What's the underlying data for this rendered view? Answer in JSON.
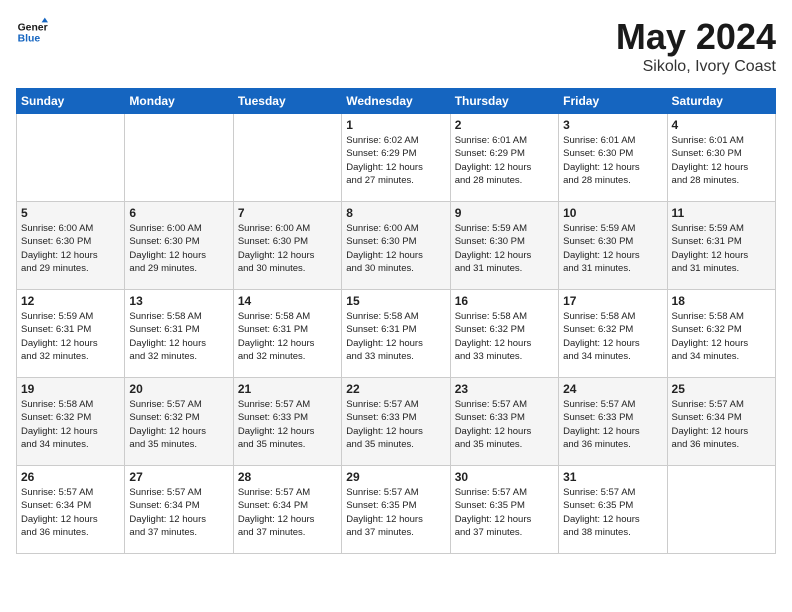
{
  "header": {
    "logo_line1": "General",
    "logo_line2": "Blue",
    "title": "May 2024",
    "subtitle": "Sikolo, Ivory Coast"
  },
  "days_of_week": [
    "Sunday",
    "Monday",
    "Tuesday",
    "Wednesday",
    "Thursday",
    "Friday",
    "Saturday"
  ],
  "weeks": [
    [
      {
        "day": "",
        "info": ""
      },
      {
        "day": "",
        "info": ""
      },
      {
        "day": "",
        "info": ""
      },
      {
        "day": "1",
        "info": "Sunrise: 6:02 AM\nSunset: 6:29 PM\nDaylight: 12 hours\nand 27 minutes."
      },
      {
        "day": "2",
        "info": "Sunrise: 6:01 AM\nSunset: 6:29 PM\nDaylight: 12 hours\nand 28 minutes."
      },
      {
        "day": "3",
        "info": "Sunrise: 6:01 AM\nSunset: 6:30 PM\nDaylight: 12 hours\nand 28 minutes."
      },
      {
        "day": "4",
        "info": "Sunrise: 6:01 AM\nSunset: 6:30 PM\nDaylight: 12 hours\nand 28 minutes."
      }
    ],
    [
      {
        "day": "5",
        "info": "Sunrise: 6:00 AM\nSunset: 6:30 PM\nDaylight: 12 hours\nand 29 minutes."
      },
      {
        "day": "6",
        "info": "Sunrise: 6:00 AM\nSunset: 6:30 PM\nDaylight: 12 hours\nand 29 minutes."
      },
      {
        "day": "7",
        "info": "Sunrise: 6:00 AM\nSunset: 6:30 PM\nDaylight: 12 hours\nand 30 minutes."
      },
      {
        "day": "8",
        "info": "Sunrise: 6:00 AM\nSunset: 6:30 PM\nDaylight: 12 hours\nand 30 minutes."
      },
      {
        "day": "9",
        "info": "Sunrise: 5:59 AM\nSunset: 6:30 PM\nDaylight: 12 hours\nand 31 minutes."
      },
      {
        "day": "10",
        "info": "Sunrise: 5:59 AM\nSunset: 6:30 PM\nDaylight: 12 hours\nand 31 minutes."
      },
      {
        "day": "11",
        "info": "Sunrise: 5:59 AM\nSunset: 6:31 PM\nDaylight: 12 hours\nand 31 minutes."
      }
    ],
    [
      {
        "day": "12",
        "info": "Sunrise: 5:59 AM\nSunset: 6:31 PM\nDaylight: 12 hours\nand 32 minutes."
      },
      {
        "day": "13",
        "info": "Sunrise: 5:58 AM\nSunset: 6:31 PM\nDaylight: 12 hours\nand 32 minutes."
      },
      {
        "day": "14",
        "info": "Sunrise: 5:58 AM\nSunset: 6:31 PM\nDaylight: 12 hours\nand 32 minutes."
      },
      {
        "day": "15",
        "info": "Sunrise: 5:58 AM\nSunset: 6:31 PM\nDaylight: 12 hours\nand 33 minutes."
      },
      {
        "day": "16",
        "info": "Sunrise: 5:58 AM\nSunset: 6:32 PM\nDaylight: 12 hours\nand 33 minutes."
      },
      {
        "day": "17",
        "info": "Sunrise: 5:58 AM\nSunset: 6:32 PM\nDaylight: 12 hours\nand 34 minutes."
      },
      {
        "day": "18",
        "info": "Sunrise: 5:58 AM\nSunset: 6:32 PM\nDaylight: 12 hours\nand 34 minutes."
      }
    ],
    [
      {
        "day": "19",
        "info": "Sunrise: 5:58 AM\nSunset: 6:32 PM\nDaylight: 12 hours\nand 34 minutes."
      },
      {
        "day": "20",
        "info": "Sunrise: 5:57 AM\nSunset: 6:32 PM\nDaylight: 12 hours\nand 35 minutes."
      },
      {
        "day": "21",
        "info": "Sunrise: 5:57 AM\nSunset: 6:33 PM\nDaylight: 12 hours\nand 35 minutes."
      },
      {
        "day": "22",
        "info": "Sunrise: 5:57 AM\nSunset: 6:33 PM\nDaylight: 12 hours\nand 35 minutes."
      },
      {
        "day": "23",
        "info": "Sunrise: 5:57 AM\nSunset: 6:33 PM\nDaylight: 12 hours\nand 35 minutes."
      },
      {
        "day": "24",
        "info": "Sunrise: 5:57 AM\nSunset: 6:33 PM\nDaylight: 12 hours\nand 36 minutes."
      },
      {
        "day": "25",
        "info": "Sunrise: 5:57 AM\nSunset: 6:34 PM\nDaylight: 12 hours\nand 36 minutes."
      }
    ],
    [
      {
        "day": "26",
        "info": "Sunrise: 5:57 AM\nSunset: 6:34 PM\nDaylight: 12 hours\nand 36 minutes."
      },
      {
        "day": "27",
        "info": "Sunrise: 5:57 AM\nSunset: 6:34 PM\nDaylight: 12 hours\nand 37 minutes."
      },
      {
        "day": "28",
        "info": "Sunrise: 5:57 AM\nSunset: 6:34 PM\nDaylight: 12 hours\nand 37 minutes."
      },
      {
        "day": "29",
        "info": "Sunrise: 5:57 AM\nSunset: 6:35 PM\nDaylight: 12 hours\nand 37 minutes."
      },
      {
        "day": "30",
        "info": "Sunrise: 5:57 AM\nSunset: 6:35 PM\nDaylight: 12 hours\nand 37 minutes."
      },
      {
        "day": "31",
        "info": "Sunrise: 5:57 AM\nSunset: 6:35 PM\nDaylight: 12 hours\nand 38 minutes."
      },
      {
        "day": "",
        "info": ""
      }
    ]
  ]
}
